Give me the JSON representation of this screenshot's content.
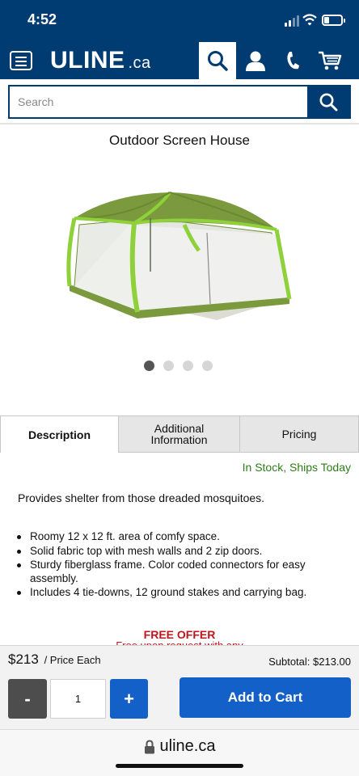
{
  "status_bar": {
    "time": "4:52"
  },
  "header": {
    "logo_main": "ULINE",
    "logo_suffix": ".ca",
    "icons": [
      "hamburger-menu-icon",
      "search-icon",
      "account-icon",
      "phone-icon",
      "cart-icon"
    ]
  },
  "search": {
    "placeholder": "Search"
  },
  "product": {
    "title": "Outdoor Screen House",
    "image_count": 4,
    "active_image": 1
  },
  "tabs": [
    {
      "label": "Description",
      "active": true
    },
    {
      "label": "Additional Information",
      "active": false
    },
    {
      "label": "Pricing",
      "active": false
    }
  ],
  "stock_status": "In Stock, Ships Today",
  "description": "Provides shelter from those dreaded mosquitoes.",
  "features": [
    "Roomy 12 x 12 ft. area of comfy space.",
    "Solid fabric top with mesh walls and 2 zip doors.",
    "Sturdy fiberglass frame. Color coded connectors for easy assembly.",
    "Includes 4 tie-downs, 12 ground stakes and carrying bag."
  ],
  "offer": {
    "title": "FREE OFFER",
    "subtitle": "Free upon request with any"
  },
  "purchase": {
    "price": "$213",
    "price_unit": "/ Price Each",
    "subtotal": "Subtotal: $213.00",
    "minus_label": "-",
    "quantity": "1",
    "plus_label": "+",
    "add_to_cart": "Add to Cart"
  },
  "browser": {
    "url": "uline.ca"
  },
  "colors": {
    "brand_blue": "#003b71",
    "button_blue": "#1360c9",
    "stock_green": "#2e7d1a",
    "offer_red": "#c0161b",
    "tent_green": "#7b9a3e",
    "tent_lime": "#8fd13a"
  }
}
